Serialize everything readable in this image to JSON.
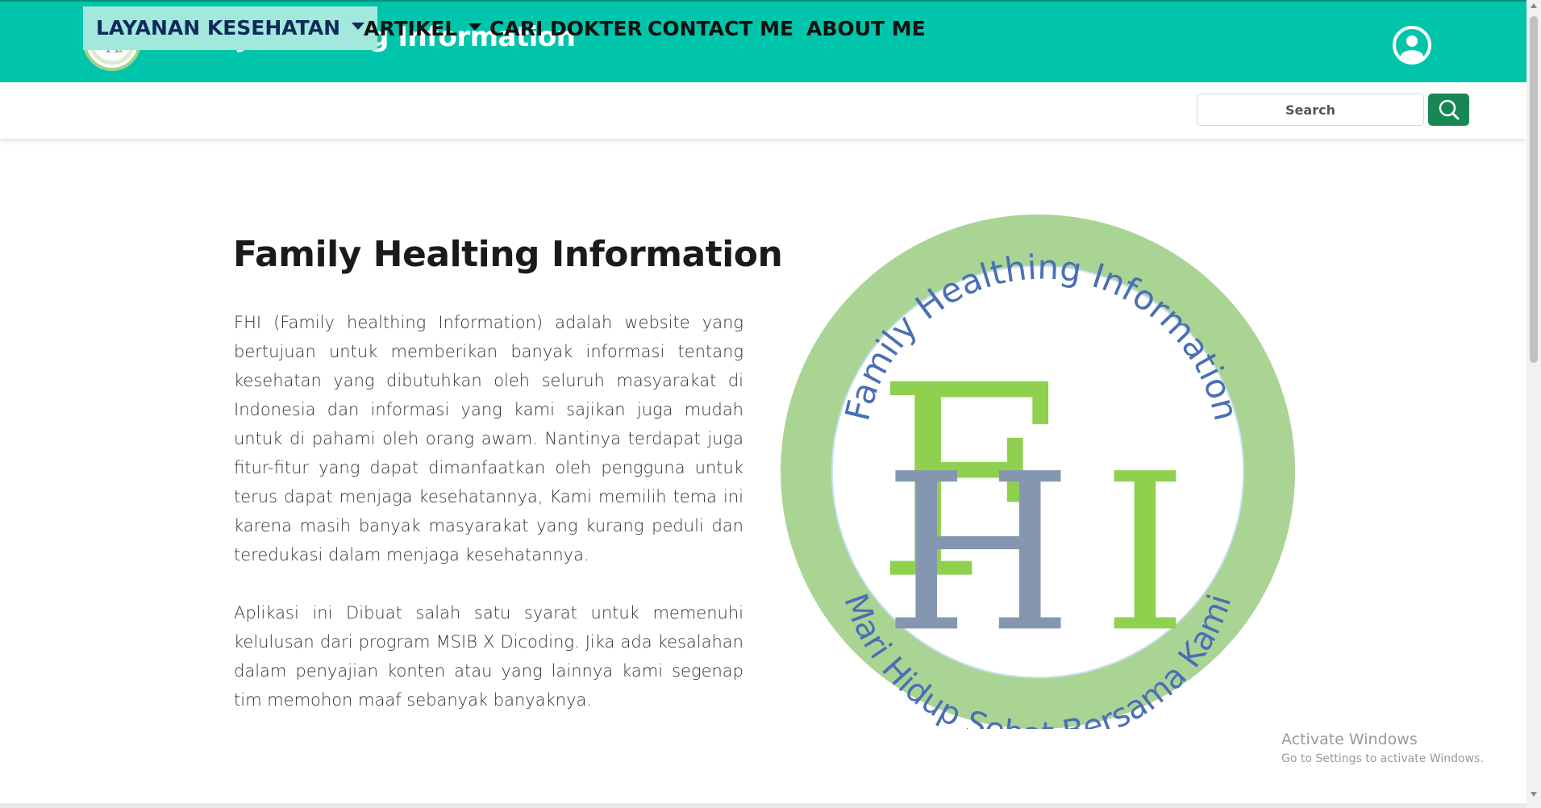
{
  "brand": {
    "title": "Family Healting Information",
    "logo_letters": "FHI",
    "colors": {
      "primary": "#00c5aa",
      "nav_active_bg": "#a3e8dc",
      "search_button": "#198754"
    }
  },
  "header": {
    "user_icon": "user-circle-icon"
  },
  "nav": {
    "items": [
      {
        "label": "LAYANAN KESEHATAN",
        "dropdown": true,
        "active": true
      },
      {
        "label": "ARTIKEL",
        "dropdown": true,
        "active": false
      },
      {
        "label": "CARI DOKTER",
        "dropdown": false,
        "active": false
      },
      {
        "label": "CONTACT ME",
        "dropdown": false,
        "active": false
      },
      {
        "label": "ABOUT ME",
        "dropdown": false,
        "active": false
      }
    ],
    "search_placeholder": "Search",
    "search_icon": "search-icon"
  },
  "main": {
    "title": "Family Healting Information",
    "paragraph1": "FHI (Family healthing Information) adalah website yang bertujuan untuk memberikan banyak informasi tentang kesehatan yang dibutuhkan oleh seluruh masyarakat di Indonesia dan informasi yang kami sajikan juga mudah untuk di pahami oleh orang awam. Nantinya terdapat juga fitur-fitur yang dapat dimanfaatkan oleh pengguna untuk terus dapat menjaga kesehatannya, Kami memilih tema ini karena masih banyak masyarakat yang kurang peduli dan teredukasi dalam menjaga kesehatannya.",
    "paragraph2": "Aplikasi ini Dibuat salah satu syarat untuk memenuhi kelulusan dari program MSIB X Dicoding. Jika ada kesalahan dalam penyajian konten atau yang lainnya kami segenap tim memohon maaf sebanyak banyaknya.",
    "logo": {
      "top_text": "Family Healthing Information",
      "bottom_text": "Mari Hidup Sehat Bersama Kami",
      "letter_f": "F",
      "letter_h": "H",
      "letter_i": "I",
      "ring_color": "#a5d28e",
      "text_color": "#4a6fb5",
      "green": "#8fd14f",
      "slate": "#8597b0"
    }
  },
  "overlay": {
    "activate_title": "Activate Windows",
    "activate_sub": "Go to Settings to activate Windows."
  }
}
